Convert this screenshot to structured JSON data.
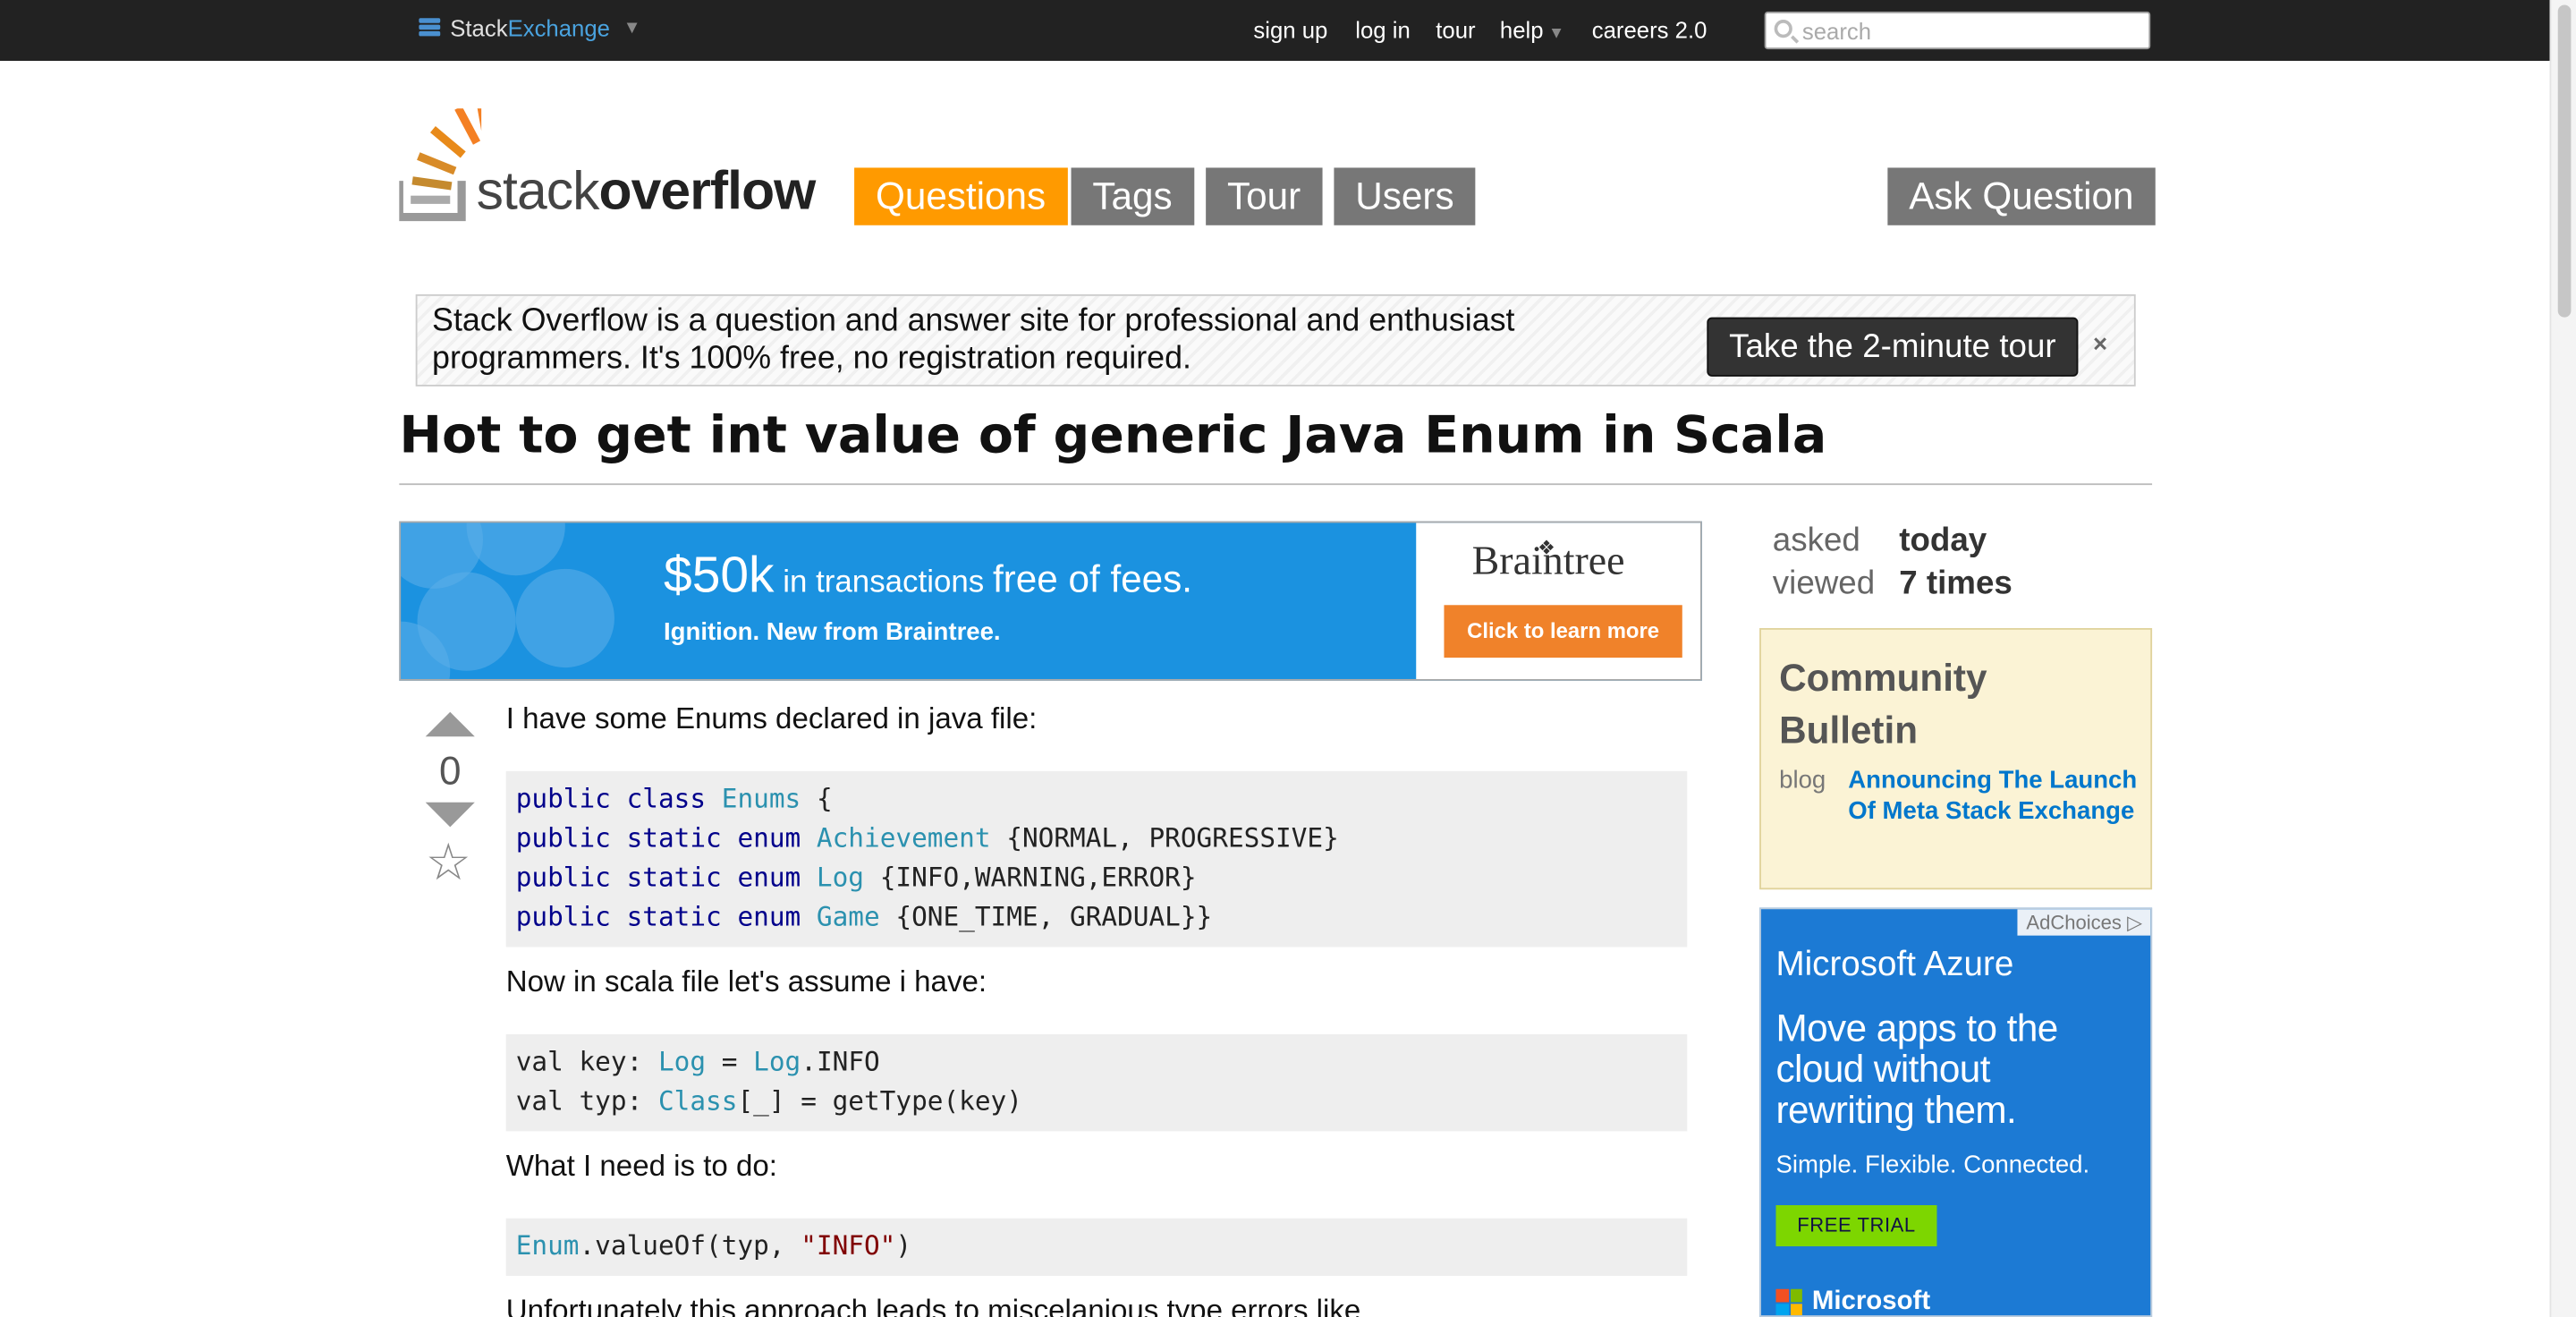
{
  "topbar": {
    "brand_part1": "Stack",
    "brand_part2": "Exchange",
    "links": {
      "signup": "sign up",
      "login": "log in",
      "tour": "tour",
      "help": "help",
      "careers": "careers 2.0"
    },
    "search_placeholder": "search"
  },
  "header": {
    "logo_part1": "stack",
    "logo_part2": "overflow",
    "nav": {
      "questions": "Questions",
      "tags": "Tags",
      "tour": "Tour",
      "users": "Users"
    },
    "ask_button": "Ask Question"
  },
  "banner": {
    "line1": "Stack Overflow is a question and answer site for professional and enthusiast",
    "line2": "programmers. It's 100% free, no registration required.",
    "tour_button": "Take the 2-minute tour",
    "close": "×"
  },
  "question": {
    "title": "Hot to get int value of generic Java Enum in Scala",
    "votes": "0",
    "p1": "I have some Enums declared in java file:",
    "p2": "Now in scala file let's assume i have:",
    "p3": "What I need is to do:",
    "p4": "Unfortunately this approach leads to miscelanious type errors like"
  },
  "ad_braintree": {
    "amount": "$50k",
    "phrase1": " in transactions ",
    "phrase2": "free of fees.",
    "sub": "Ignition. New from Braintree.",
    "brand": "Braintree",
    "cta": "Click to learn more"
  },
  "sidebar": {
    "asked_label": "asked",
    "asked_value": "today",
    "viewed_label": "viewed",
    "viewed_value": "7 times",
    "bulletin": {
      "heading": "Community Bulletin",
      "tag": "blog",
      "link": "Announcing The Launch Of Meta Stack Exchange"
    },
    "ad_azure": {
      "adchoices": "AdChoices",
      "title": "Microsoft Azure",
      "headline": "Move apps to the cloud without rewriting them.",
      "tagline": "Simple. Flexible. Connected.",
      "cta": "FREE TRIAL",
      "brand": "Microsoft"
    }
  },
  "colors": {
    "topbar": "#222222",
    "nav_active": "#ff9a00",
    "nav_inactive": "#777777",
    "link": "#0077cc",
    "code_background": "#eeeeee",
    "bulletin_background": "#fbf3d5",
    "braintree_blue": "#1b92e0",
    "azure_blue": "#1c7ad4"
  },
  "icons": [
    "stackexchange-icon",
    "search-icon",
    "stackoverflow-logo",
    "vote-up-icon",
    "vote-down-icon",
    "favorite-star-icon",
    "microsoft-logo"
  ]
}
